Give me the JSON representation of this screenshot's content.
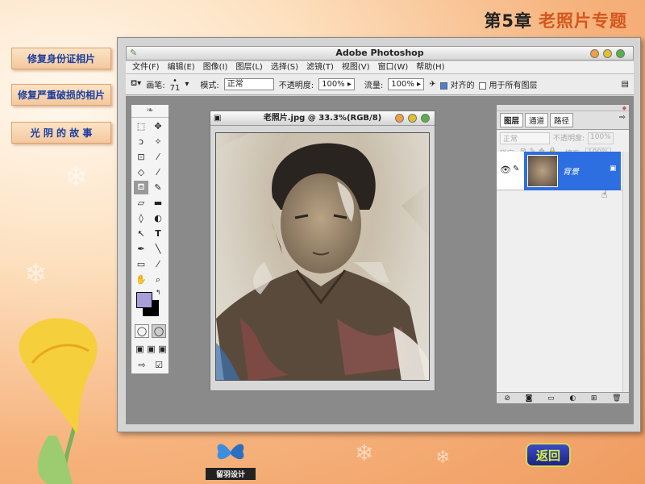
{
  "header": {
    "chapter": "第5章",
    "title": "老照片专题"
  },
  "nav": [
    "修复身份证相片",
    "修复严重破损的相片",
    "光 阴 的 故 事"
  ],
  "app": {
    "title": "Adobe Photoshop",
    "menu": [
      "文件(F)",
      "编辑(E)",
      "图像(I)",
      "图层(L)",
      "选择(S)",
      "滤镜(T)",
      "视图(V)",
      "窗口(W)",
      "帮助(H)"
    ],
    "options": {
      "brush_label": "画笔:",
      "brush_size": "71",
      "mode_label": "模式:",
      "mode_value": "正常",
      "opacity_label": "不透明度:",
      "opacity_value": "100%",
      "flow_label": "流量:",
      "flow_value": "100%",
      "aligned_label": "对齐的",
      "all_layers_label": "用于所有图层"
    },
    "document": {
      "title": "老照片.jpg @ 33.3%(RGB/8)"
    },
    "layers_panel": {
      "tabs": [
        "图层",
        "通道",
        "路径"
      ],
      "blend_mode": "正常",
      "opacity_label": "不透明度:",
      "opacity_value": "100%",
      "lock_label": "锁定:",
      "fill_label": "填充:",
      "fill_value": "100%",
      "layer_name": "背景"
    }
  },
  "footer": {
    "logo_text": "留羽设计",
    "back_label": "返回"
  },
  "colors": {
    "accent": "#d4561c",
    "nav_text": "#1a3e9e",
    "selection": "#2d6ee0",
    "foreground": "#a79fd8",
    "background": "#000000"
  }
}
